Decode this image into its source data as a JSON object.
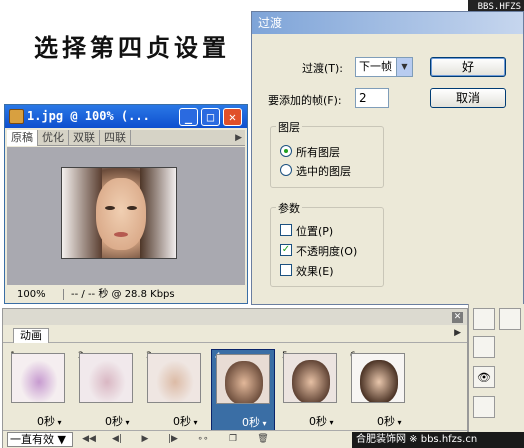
{
  "heading": "选择第四贞设置",
  "corner_logo": "BBS.HFZS",
  "image_window": {
    "title": "1.jpg @ 100% (...",
    "tabs": [
      "原稿",
      "优化",
      "双联",
      "四联"
    ],
    "zoom": "100%",
    "info": "-- / -- 秒 @ 28.8 Kbps"
  },
  "dialog": {
    "title": "过渡",
    "tween_label": "过渡(T):",
    "tween_value": "下一帧",
    "frames_label": "要添加的帧(F):",
    "frames_value": "2",
    "ok_label": "好",
    "cancel_label": "取消",
    "layers_group": "图层",
    "all_layers": "所有图层",
    "selected_layers": "选中的图层",
    "params_group": "参数",
    "position": "位置(P)",
    "opacity": "不透明度(O)",
    "effects": "效果(E)",
    "position_checked": false,
    "opacity_checked": true,
    "effects_checked": false
  },
  "animation": {
    "tab": "动画",
    "frames": [
      {
        "num": "1",
        "delay": "0秒"
      },
      {
        "num": "2",
        "delay": "0秒"
      },
      {
        "num": "3",
        "delay": "0秒"
      },
      {
        "num": "4",
        "delay": "0秒"
      },
      {
        "num": "5",
        "delay": "0秒"
      },
      {
        "num": "6",
        "delay": "0秒"
      }
    ],
    "selected_frame": 4,
    "loop": "一直有效"
  },
  "footer": "合肥装饰网 ※ bbs.hfzs.cn"
}
